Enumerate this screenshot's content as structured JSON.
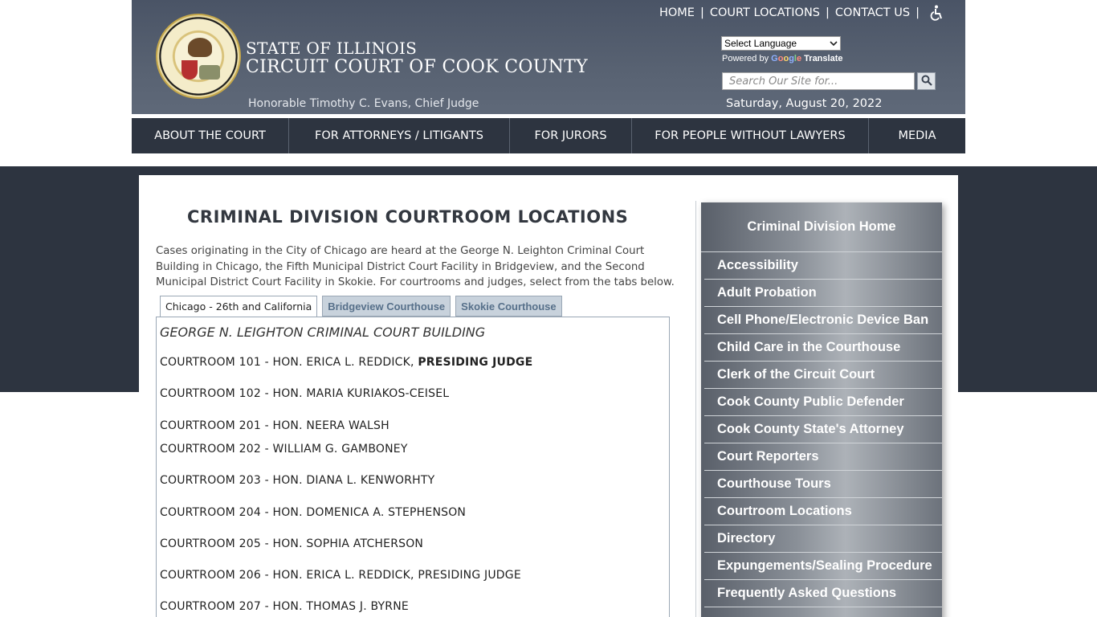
{
  "header": {
    "state_title": "STATE OF ILLINOIS",
    "court_title": "CIRCUIT COURT OF COOK COUNTY",
    "chief_judge": "Honorable Timothy C. Evans, Chief Judge",
    "date": "Saturday, August 20, 2022",
    "top_links": [
      "HOME",
      "COURT LOCATIONS",
      "CONTACT US"
    ],
    "language_select": "Select Language",
    "powered_by": "Powered by",
    "google": [
      "G",
      "o",
      "o",
      "g",
      "l",
      "e"
    ],
    "translate": "Translate",
    "search_placeholder": "Search Our Site for..."
  },
  "nav": [
    "ABOUT THE COURT",
    "FOR ATTORNEYS / LITIGANTS",
    "FOR JURORS",
    "FOR PEOPLE WITHOUT LAWYERS",
    "MEDIA"
  ],
  "main": {
    "title": "CRIMINAL DIVISION COURTROOM LOCATIONS",
    "intro": "Cases originating in the City of Chicago are heard at the George N. Leighton Criminal Court Building in Chicago, the Fifth Municipal District Court Facility in Bridgeview, and the Second Municipal District Court Facility in Skokie. For courtrooms and judges, select from the tabs below.",
    "tabs": [
      "Chicago - 26th and California",
      "Bridgeview Courthouse",
      "Skokie Courthouse"
    ],
    "building": "GEORGE N. LEIGHTON CRIMINAL COURT BUILDING",
    "courtrooms": [
      {
        "text": "COURTROOM 101 - HON. ERICA L. REDDICK, ",
        "bold": "PRESIDING JUDGE"
      },
      {
        "text": "COURTROOM 102 - HON. MARIA KURIAKOS-CEISEL",
        "bold": ""
      },
      {
        "text": "COURTROOM 201 - HON. NEERA WALSH",
        "bold": ""
      },
      {
        "text": "COURTROOM 202 - WILLIAM G. GAMBONEY",
        "bold": ""
      },
      {
        "text": "COURTROOM 203 - HON. DIANA L. KENWORHTY",
        "bold": ""
      },
      {
        "text": "COURTROOM 204 - HON. DOMENICA A. STEPHENSON",
        "bold": ""
      },
      {
        "text": "COURTROOM 205 - HON. SOPHIA ATCHERSON",
        "bold": ""
      },
      {
        "text": "COURTROOM 206 - HON. ERICA L. REDDICK, PRESIDING JUDGE",
        "bold": ""
      },
      {
        "text": "COURTROOM 207 - HON. THOMAS J. BYRNE",
        "bold": ""
      }
    ]
  },
  "sidebar": {
    "heading": "Criminal Division Home",
    "items": [
      "Accessibility",
      "Adult Probation",
      "Cell Phone/Electronic Device Ban",
      "Child Care in the Courthouse",
      "Clerk of the Circuit Court",
      "Cook County Public Defender",
      "Cook County State's Attorney",
      "Court Reporters",
      "Courthouse Tours",
      "Courtroom Locations",
      "Directory",
      "Expungements/Sealing Procedure",
      "Frequently Asked Questions"
    ]
  },
  "icons": {
    "accessibility": "wheelchair-icon",
    "search": "magnifier-icon",
    "seal": "illinois-seal-logo"
  }
}
